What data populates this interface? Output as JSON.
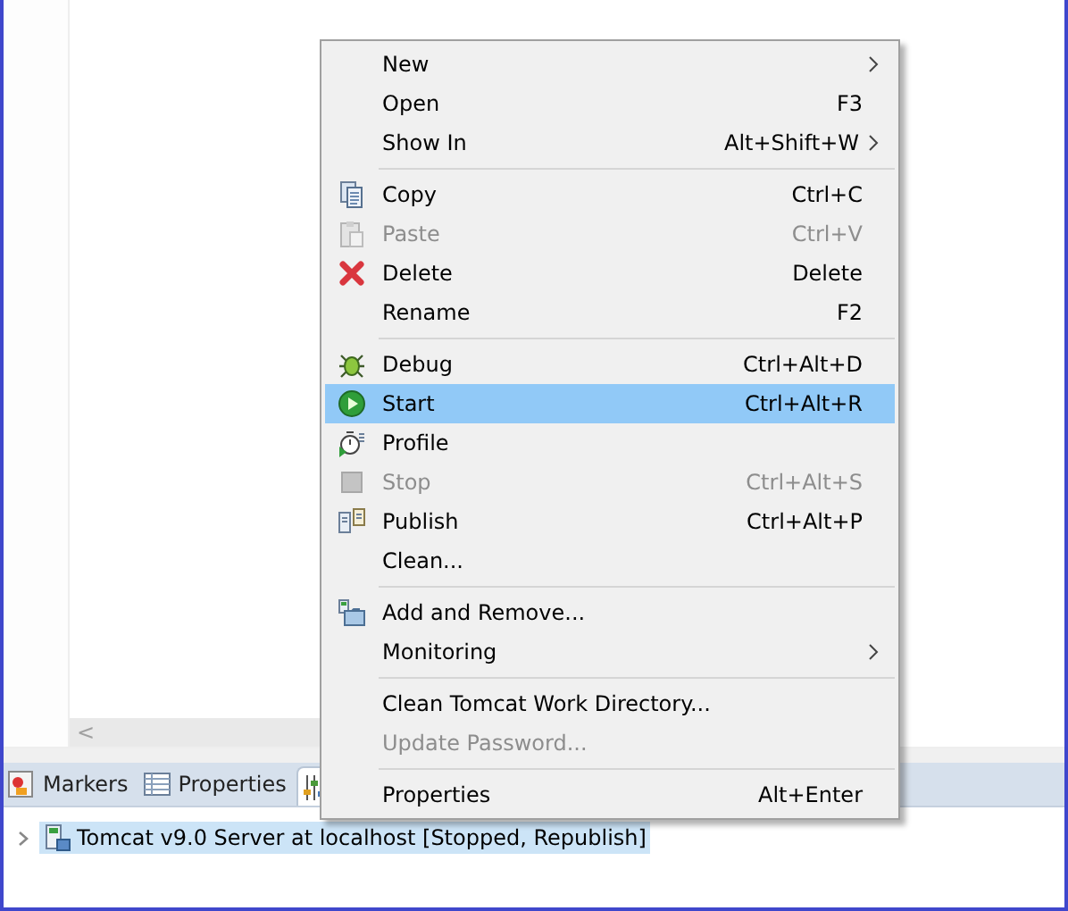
{
  "editor": {
    "scroll_arrow": "<"
  },
  "views": {
    "tabs": [
      {
        "label": "Markers",
        "selected": false
      },
      {
        "label": "Properties",
        "selected": false
      },
      {
        "selected": true
      }
    ],
    "tree": [
      {
        "label": "Tomcat v9.0 Server at localhost  [Stopped, Republish]",
        "expanded": false,
        "selected": true
      }
    ]
  },
  "context_menu": {
    "groups": [
      [
        {
          "label": "New",
          "submenu": true,
          "disabled": false,
          "selected": false
        },
        {
          "label": "Open",
          "shortcut": "F3",
          "submenu": false,
          "disabled": false,
          "selected": false
        },
        {
          "label": "Show In",
          "shortcut": "Alt+Shift+W",
          "submenu": true,
          "disabled": false,
          "selected": false
        }
      ],
      [
        {
          "label": "Copy",
          "shortcut": "Ctrl+C",
          "submenu": false,
          "disabled": false,
          "selected": false
        },
        {
          "label": "Paste",
          "shortcut": "Ctrl+V",
          "submenu": false,
          "disabled": true,
          "selected": false
        },
        {
          "label": "Delete",
          "shortcut": "Delete",
          "submenu": false,
          "disabled": false,
          "selected": false
        },
        {
          "label": "Rename",
          "shortcut": "F2",
          "submenu": false,
          "disabled": false,
          "selected": false
        }
      ],
      [
        {
          "label": "Debug",
          "shortcut": "Ctrl+Alt+D",
          "submenu": false,
          "disabled": false,
          "selected": false
        },
        {
          "label": "Start",
          "shortcut": "Ctrl+Alt+R",
          "submenu": false,
          "disabled": false,
          "selected": true
        },
        {
          "label": "Profile",
          "submenu": false,
          "disabled": false,
          "selected": false
        },
        {
          "label": "Stop",
          "shortcut": "Ctrl+Alt+S",
          "submenu": false,
          "disabled": true,
          "selected": false
        },
        {
          "label": "Publish",
          "shortcut": "Ctrl+Alt+P",
          "submenu": false,
          "disabled": false,
          "selected": false
        },
        {
          "label": "Clean...",
          "submenu": false,
          "disabled": false,
          "selected": false
        }
      ],
      [
        {
          "label": "Add and Remove...",
          "submenu": false,
          "disabled": false,
          "selected": false
        },
        {
          "label": "Monitoring",
          "submenu": true,
          "disabled": false,
          "selected": false
        }
      ],
      [
        {
          "label": "Clean Tomcat Work Directory...",
          "submenu": false,
          "disabled": false,
          "selected": false
        },
        {
          "label": "Update Password...",
          "submenu": false,
          "disabled": true,
          "selected": false
        }
      ],
      [
        {
          "label": "Properties",
          "shortcut": "Alt+Enter",
          "submenu": false,
          "disabled": false,
          "selected": false
        }
      ]
    ]
  }
}
